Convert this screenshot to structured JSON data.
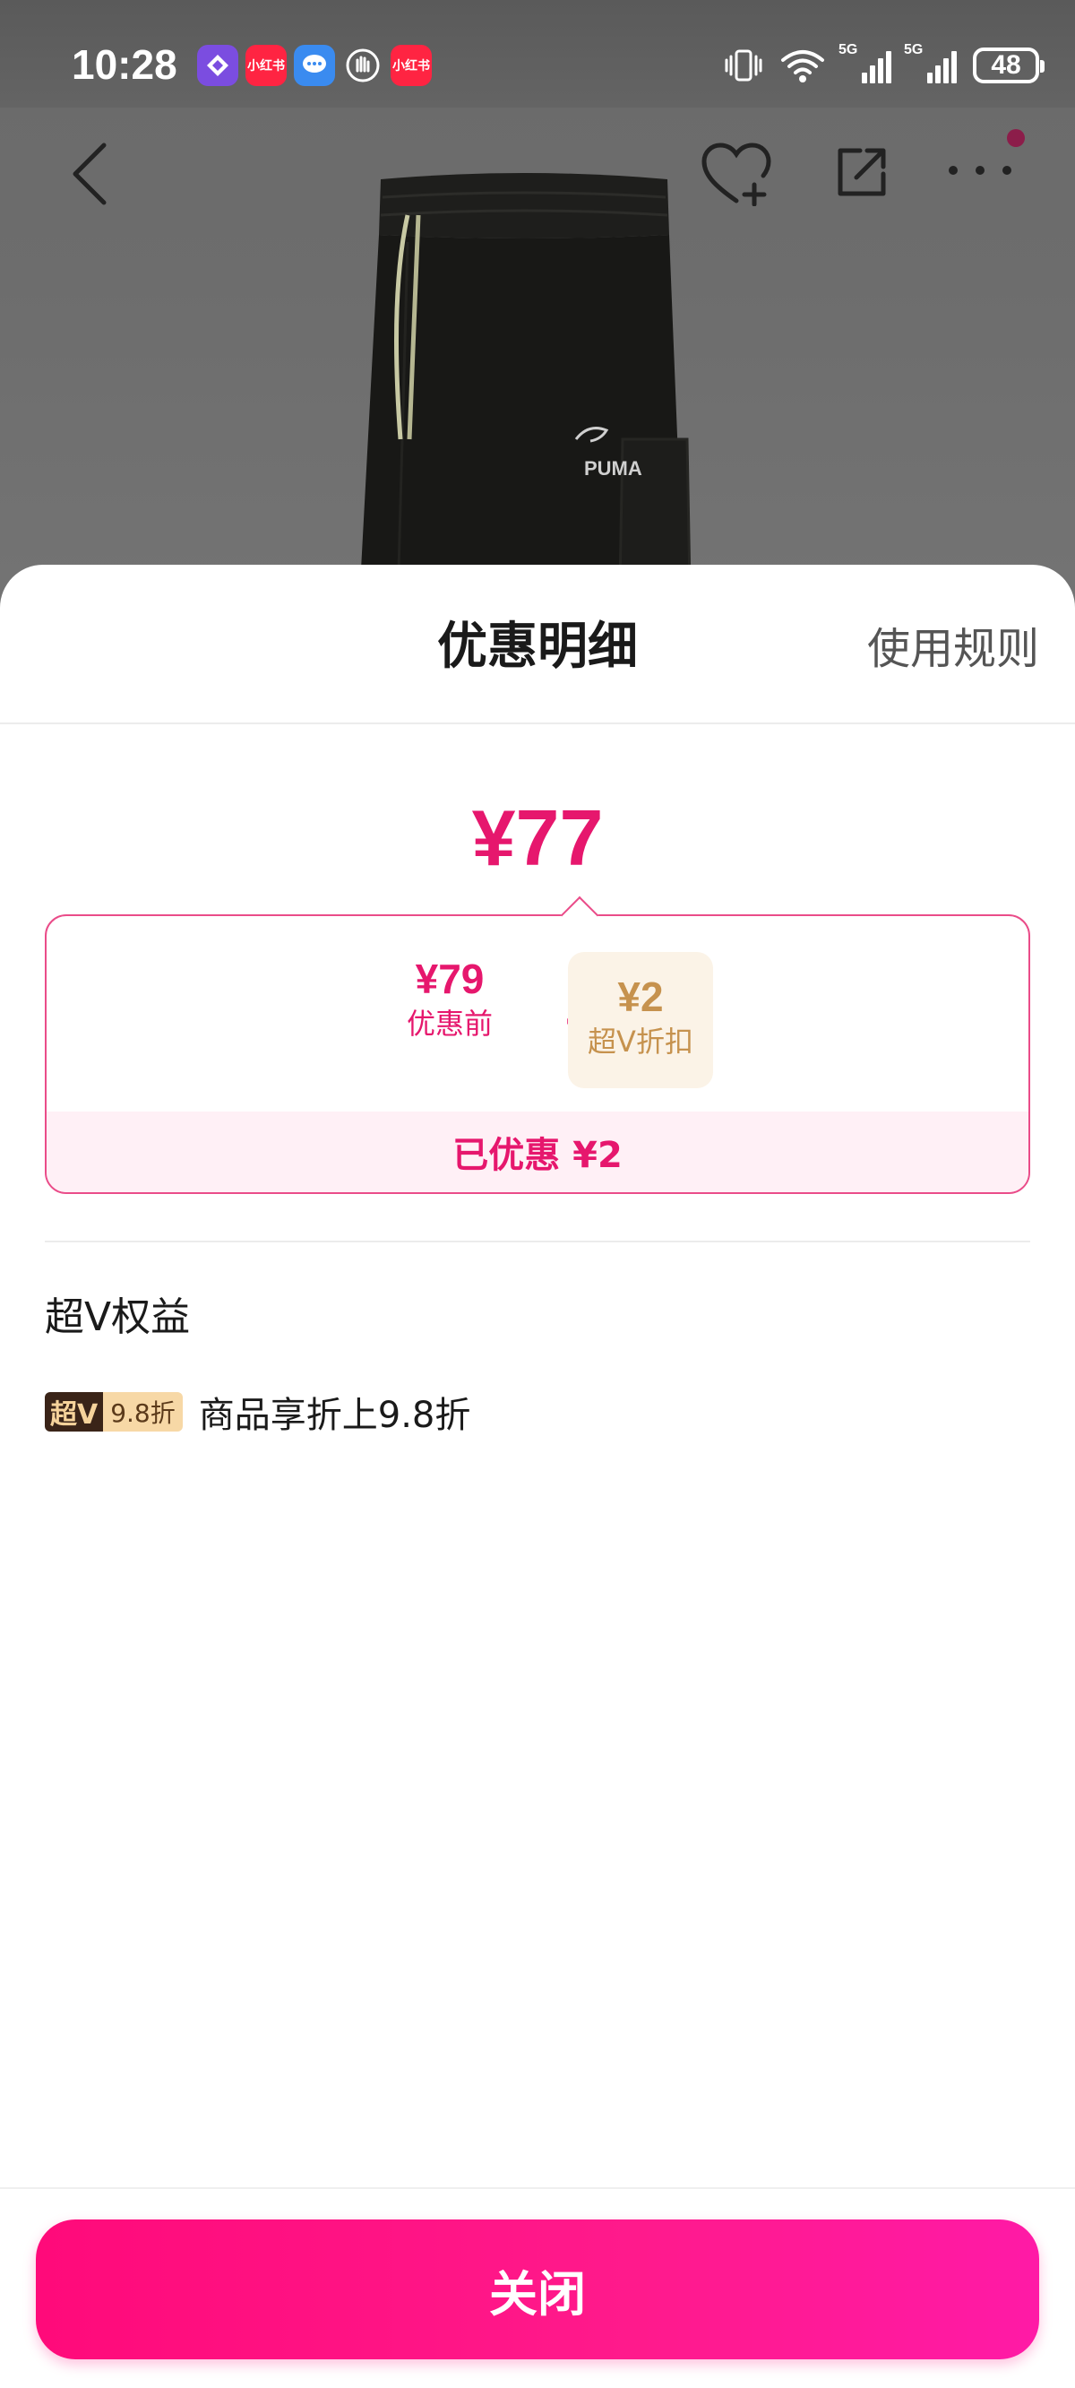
{
  "status_bar": {
    "time": "10:28",
    "battery": "48",
    "network_1": "5G",
    "network_2": "5G",
    "notification_icons": [
      "app-icon",
      "xiaohongshu-icon",
      "message-icon",
      "hand-icon",
      "xiaohongshu-icon"
    ]
  },
  "product_page": {
    "nav_icons": [
      "back-icon",
      "favorite-add-icon",
      "share-icon",
      "more-icon"
    ],
    "product_brand_mark": "PUMA"
  },
  "sheet": {
    "title": "优惠明细",
    "rules_link": "使用规则",
    "final_price": "¥77",
    "breakdown": {
      "before_amount": "¥79",
      "before_label": "优惠前",
      "operator": "-",
      "discount_amount": "¥2",
      "discount_label": "超V折扣",
      "saved_text": "已优惠 ¥2"
    },
    "benefits": {
      "title": "超V权益",
      "badge_left": "超V",
      "badge_right": "9.8折",
      "description": "商品享折上9.8折"
    },
    "close_label": "关闭"
  },
  "colors": {
    "accent": "#e6176d",
    "discount_gold": "#c6924e",
    "button_gradient_start": "#ff0a7a",
    "button_gradient_end": "#ff1aa6"
  }
}
